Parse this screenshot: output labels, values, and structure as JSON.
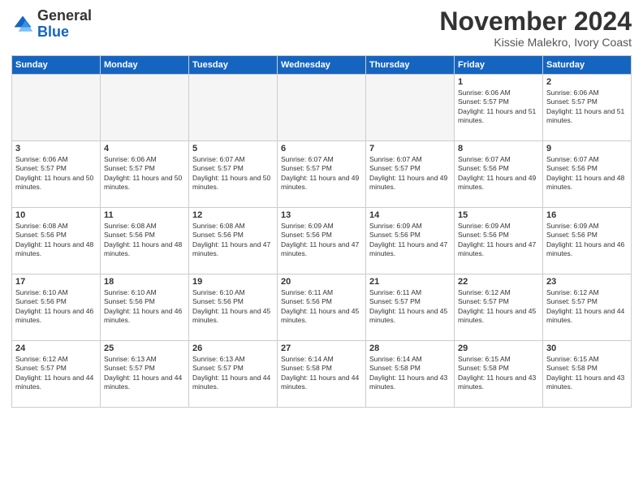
{
  "logo": {
    "text_general": "General",
    "text_blue": "Blue"
  },
  "header": {
    "month": "November 2024",
    "location": "Kissie Malekro, Ivory Coast"
  },
  "weekdays": [
    "Sunday",
    "Monday",
    "Tuesday",
    "Wednesday",
    "Thursday",
    "Friday",
    "Saturday"
  ],
  "weeks": [
    [
      {
        "day": "",
        "empty": true
      },
      {
        "day": "",
        "empty": true
      },
      {
        "day": "",
        "empty": true
      },
      {
        "day": "",
        "empty": true
      },
      {
        "day": "",
        "empty": true
      },
      {
        "day": "1",
        "sunrise": "6:06 AM",
        "sunset": "5:57 PM",
        "daylight": "11 hours and 51 minutes."
      },
      {
        "day": "2",
        "sunrise": "6:06 AM",
        "sunset": "5:57 PM",
        "daylight": "11 hours and 51 minutes."
      }
    ],
    [
      {
        "day": "3",
        "sunrise": "6:06 AM",
        "sunset": "5:57 PM",
        "daylight": "11 hours and 50 minutes."
      },
      {
        "day": "4",
        "sunrise": "6:06 AM",
        "sunset": "5:57 PM",
        "daylight": "11 hours and 50 minutes."
      },
      {
        "day": "5",
        "sunrise": "6:07 AM",
        "sunset": "5:57 PM",
        "daylight": "11 hours and 50 minutes."
      },
      {
        "day": "6",
        "sunrise": "6:07 AM",
        "sunset": "5:57 PM",
        "daylight": "11 hours and 49 minutes."
      },
      {
        "day": "7",
        "sunrise": "6:07 AM",
        "sunset": "5:57 PM",
        "daylight": "11 hours and 49 minutes."
      },
      {
        "day": "8",
        "sunrise": "6:07 AM",
        "sunset": "5:56 PM",
        "daylight": "11 hours and 49 minutes."
      },
      {
        "day": "9",
        "sunrise": "6:07 AM",
        "sunset": "5:56 PM",
        "daylight": "11 hours and 48 minutes."
      }
    ],
    [
      {
        "day": "10",
        "sunrise": "6:08 AM",
        "sunset": "5:56 PM",
        "daylight": "11 hours and 48 minutes."
      },
      {
        "day": "11",
        "sunrise": "6:08 AM",
        "sunset": "5:56 PM",
        "daylight": "11 hours and 48 minutes."
      },
      {
        "day": "12",
        "sunrise": "6:08 AM",
        "sunset": "5:56 PM",
        "daylight": "11 hours and 47 minutes."
      },
      {
        "day": "13",
        "sunrise": "6:09 AM",
        "sunset": "5:56 PM",
        "daylight": "11 hours and 47 minutes."
      },
      {
        "day": "14",
        "sunrise": "6:09 AM",
        "sunset": "5:56 PM",
        "daylight": "11 hours and 47 minutes."
      },
      {
        "day": "15",
        "sunrise": "6:09 AM",
        "sunset": "5:56 PM",
        "daylight": "11 hours and 47 minutes."
      },
      {
        "day": "16",
        "sunrise": "6:09 AM",
        "sunset": "5:56 PM",
        "daylight": "11 hours and 46 minutes."
      }
    ],
    [
      {
        "day": "17",
        "sunrise": "6:10 AM",
        "sunset": "5:56 PM",
        "daylight": "11 hours and 46 minutes."
      },
      {
        "day": "18",
        "sunrise": "6:10 AM",
        "sunset": "5:56 PM",
        "daylight": "11 hours and 46 minutes."
      },
      {
        "day": "19",
        "sunrise": "6:10 AM",
        "sunset": "5:56 PM",
        "daylight": "11 hours and 45 minutes."
      },
      {
        "day": "20",
        "sunrise": "6:11 AM",
        "sunset": "5:56 PM",
        "daylight": "11 hours and 45 minutes."
      },
      {
        "day": "21",
        "sunrise": "6:11 AM",
        "sunset": "5:57 PM",
        "daylight": "11 hours and 45 minutes."
      },
      {
        "day": "22",
        "sunrise": "6:12 AM",
        "sunset": "5:57 PM",
        "daylight": "11 hours and 45 minutes."
      },
      {
        "day": "23",
        "sunrise": "6:12 AM",
        "sunset": "5:57 PM",
        "daylight": "11 hours and 44 minutes."
      }
    ],
    [
      {
        "day": "24",
        "sunrise": "6:12 AM",
        "sunset": "5:57 PM",
        "daylight": "11 hours and 44 minutes."
      },
      {
        "day": "25",
        "sunrise": "6:13 AM",
        "sunset": "5:57 PM",
        "daylight": "11 hours and 44 minutes."
      },
      {
        "day": "26",
        "sunrise": "6:13 AM",
        "sunset": "5:57 PM",
        "daylight": "11 hours and 44 minutes."
      },
      {
        "day": "27",
        "sunrise": "6:14 AM",
        "sunset": "5:58 PM",
        "daylight": "11 hours and 44 minutes."
      },
      {
        "day": "28",
        "sunrise": "6:14 AM",
        "sunset": "5:58 PM",
        "daylight": "11 hours and 43 minutes."
      },
      {
        "day": "29",
        "sunrise": "6:15 AM",
        "sunset": "5:58 PM",
        "daylight": "11 hours and 43 minutes."
      },
      {
        "day": "30",
        "sunrise": "6:15 AM",
        "sunset": "5:58 PM",
        "daylight": "11 hours and 43 minutes."
      }
    ]
  ]
}
